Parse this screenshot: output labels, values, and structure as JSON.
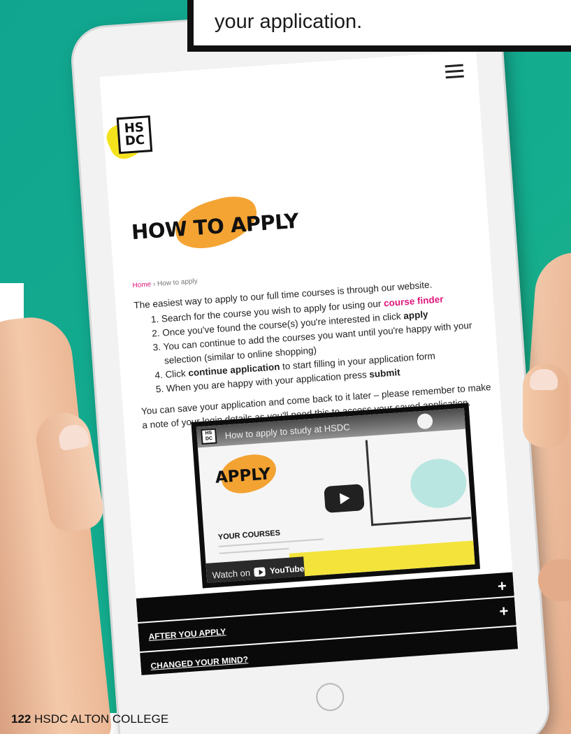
{
  "callout": {
    "text": "your application."
  },
  "site": {
    "logo_line1": "HS",
    "logo_line2": "DC",
    "page_title": "HOW TO APPLY",
    "breadcrumb": {
      "home": "Home",
      "separator": " › ",
      "current": "How to apply"
    },
    "intro": "The easiest way to apply to our full time courses is through our website.",
    "steps": [
      {
        "before": "Search for the course you wish to apply for using our ",
        "em": "course finder",
        "after": ""
      },
      {
        "before": "Once you've found the course(s) you're interested in click ",
        "em": "apply",
        "after": ""
      },
      {
        "before": "You can continue to add the courses you want until you're happy with your selection (similar to online shopping)",
        "em": "",
        "after": ""
      },
      {
        "before": "Click ",
        "em": "continue application",
        "after": " to start filling in your application form"
      },
      {
        "before": "When you are happy with your application press ",
        "em": "submit",
        "after": ""
      }
    ],
    "save_note": "You can save your application and come back to it later – please remember to make a note of your login details as you'll need this to access your saved application.",
    "video": {
      "title": "How to apply to study at HSDC",
      "logo_line1": "HS",
      "logo_line2": "DC",
      "apply_heading": "APPLY",
      "courses_heading": "YOUR COURSES",
      "watch_on": "Watch on",
      "youtube": "YouTube"
    },
    "accordion": [
      {
        "label": "AFTER YOU APPLY"
      },
      {
        "label": "CHANGED YOUR MIND?"
      }
    ],
    "accordion_icon": "+"
  },
  "footer": {
    "page_number": "122",
    "label": "HSDC ALTON COLLEGE"
  },
  "colors": {
    "background_green": "#14ad8f",
    "link_pink": "#e0167b",
    "splash_orange": "#f39a1d",
    "logo_yellow": "#f4e31c"
  },
  "icons": [
    "menu-icon",
    "play-icon",
    "youtube-icon",
    "plus-icon",
    "share-icon"
  ]
}
